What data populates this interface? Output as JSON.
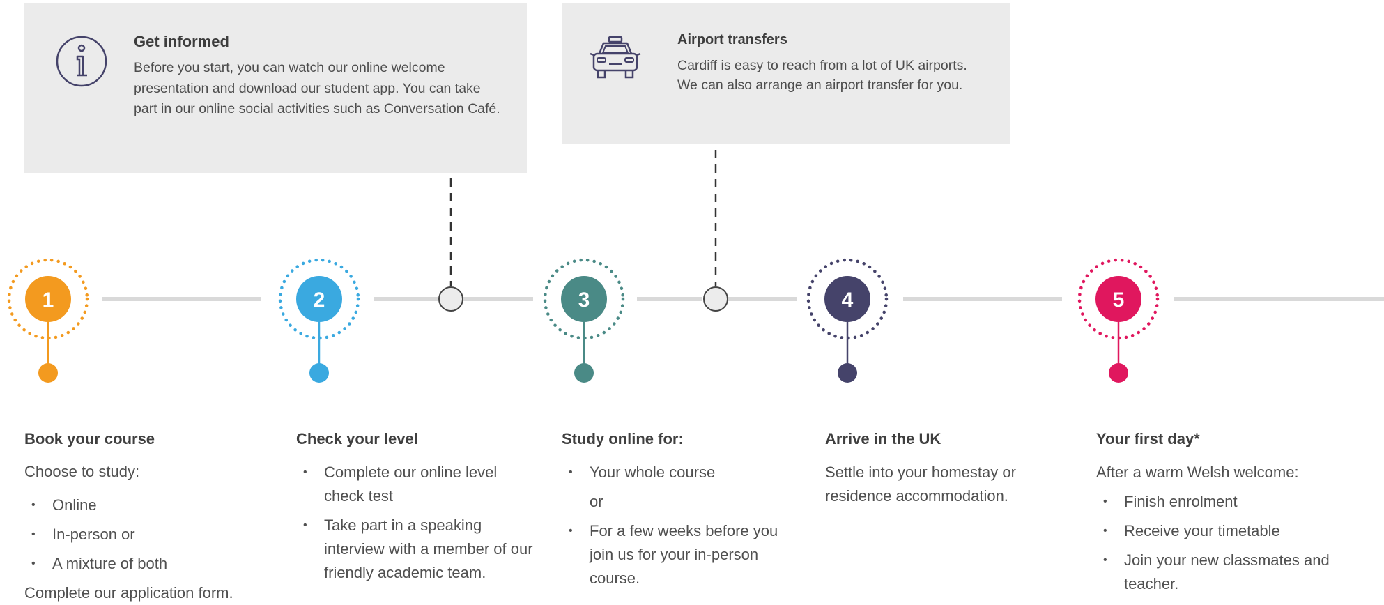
{
  "info_cards": [
    {
      "icon": "info-icon",
      "title": "Get informed",
      "body": "Before you start, you can watch our online welcome presentation and download our student app. You can take part in our online social activities such as Conversation Café."
    },
    {
      "icon": "car-icon",
      "title": "Airport transfers",
      "body": "Cardiff is easy to reach from a lot of UK airports.  We can also arrange an airport transfer for you."
    }
  ],
  "steps": [
    {
      "number": "1",
      "color": "#f39a1f",
      "title": "Book your course",
      "intro": "Choose to study:",
      "bullets": [
        "Online",
        "In-person or",
        "A mixture of both"
      ],
      "outro": "Complete our application form."
    },
    {
      "number": "2",
      "color": "#3aa9e0",
      "title": "Check your level",
      "bullets": [
        "Complete our online level check test",
        "Take part in a speaking interview with a member of our friendly academic team."
      ]
    },
    {
      "number": "3",
      "color": "#4a8a86",
      "title": "Study online for:",
      "bullets": [
        "Your whole course",
        "For a few weeks before you join us for your in-person course."
      ],
      "separator": "or"
    },
    {
      "number": "4",
      "color": "#45436a",
      "title": "Arrive in the UK",
      "body": "Settle into your homestay or residence accommodation."
    },
    {
      "number": "5",
      "color": "#e0175e",
      "title": "Your first day*",
      "intro": "After a warm Welsh welcome:",
      "bullets": [
        "Finish enrolment",
        "Receive your timetable",
        "Join your new classmates and teacher."
      ]
    }
  ]
}
